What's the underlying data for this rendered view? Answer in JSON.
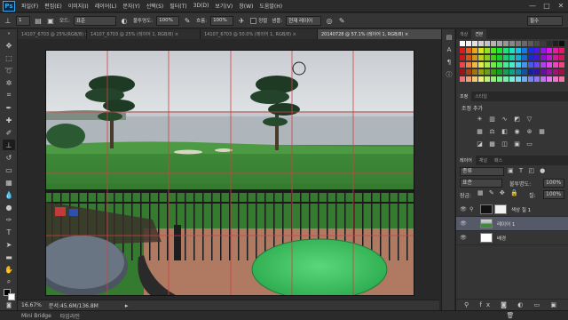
{
  "menu": {
    "logo": "Ps",
    "items": [
      "파일(F)",
      "편집(E)",
      "이미지(I)",
      "레이어(L)",
      "문자(Y)",
      "선택(S)",
      "필터(T)",
      "3D(D)",
      "보기(V)",
      "창(W)",
      "도움말(H)"
    ]
  },
  "window_controls": {
    "minimize": "—",
    "maximize": "□",
    "close": "✕"
  },
  "options_bar": {
    "brush_size": "1",
    "mode_label": "모드:",
    "mode_value": "표준",
    "opacity_label": "불투명도:",
    "opacity_value": "100%",
    "flow_label": "흐름:",
    "flow_value": "100%",
    "sample_label": "샘플:",
    "sample_value": "현재 레이어",
    "aligned_label": "정렬",
    "workspace_value": "필수"
  },
  "doc_tabs": [
    {
      "label": "14107_6703 @ 25%(RGB/8) ×",
      "active": false
    },
    {
      "label": "14107_6703 @ 25% (레이어 1, RGB/8) ×",
      "active": false
    },
    {
      "label": "14107_6703 @ 50.0% (레이어 1, RGB/8) ×",
      "active": false
    },
    {
      "label": "20140728 @ 57.1% (레이어 1, RGB/8) ×",
      "active": true
    }
  ],
  "status_bar": {
    "zoom": "16.67%",
    "doc_info": "문서:45.6M/136.8M",
    "arrow": "▸"
  },
  "bottom_bar": {
    "tab1": "Mini Bridge",
    "tab2": "타임라인"
  },
  "panels": {
    "color_tabs": [
      "색상",
      "견본"
    ],
    "adjust_tabs": [
      "조정",
      "스타일"
    ],
    "adjust_title": "조정 추가",
    "layer_tabs": [
      "레이어",
      "채널",
      "패스"
    ],
    "layer_kind": "종류",
    "blend_mode": "표준",
    "opacity_label": "불투명도:",
    "opacity_value": "100%",
    "lock_label": "잠금:",
    "fill_label": "칠:",
    "fill_value": "100%",
    "layers": [
      {
        "name": "색상 칠 1",
        "thumb": "mask",
        "selected": false
      },
      {
        "name": "레이어 1",
        "thumb": "photo",
        "selected": true
      },
      {
        "name": "배경",
        "thumb": "white",
        "selected": false
      }
    ]
  },
  "colors": {
    "accent": "#39a6f1",
    "selected_layer": "#565a68",
    "guide": "#d04040",
    "table_overlay": "#3ec25e"
  }
}
